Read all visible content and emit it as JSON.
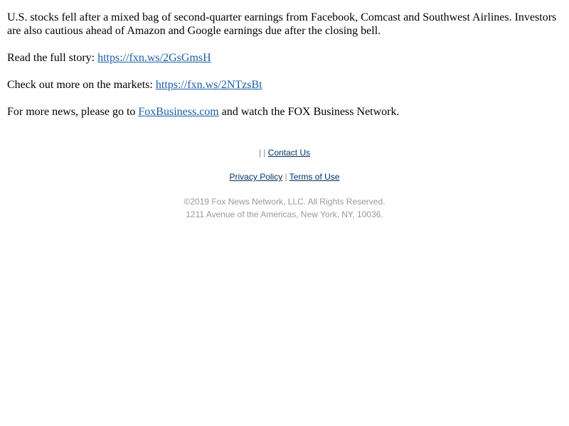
{
  "email": {
    "summary": "U.S. stocks fell after a mixed bag of second-quarter earnings from Facebook, Comcast and Southwest Airlines. Investors are also cautious ahead of Amazon and Google earnings due after the closing bell.",
    "story_prefix": "Read the full story: ",
    "story_link": "https://fxn.ws/2GsGmsH",
    "markets_prefix": "Check out more on the markets: ",
    "markets_link": "https://fxn.ws/2NTzsBt",
    "news_prefix": "For more news, please go to ",
    "news_link": "FoxBusiness.com",
    "news_suffix": " and watch the FOX Business Network."
  },
  "footer": {
    "top_separator": "| |",
    "contact_us": "Contact Us",
    "privacy_policy": "Privacy Policy",
    "links_separator": "|",
    "terms_of_use": "Terms of Use",
    "copyright": "©2019 Fox News Network, LLC. All Rights Reserved.",
    "address": "1211 Avenue of the Americas, New York, NY, 10036."
  },
  "colors": {
    "link": "#1a5ea8",
    "footer_link": "#003366",
    "legal_text": "#999999"
  }
}
